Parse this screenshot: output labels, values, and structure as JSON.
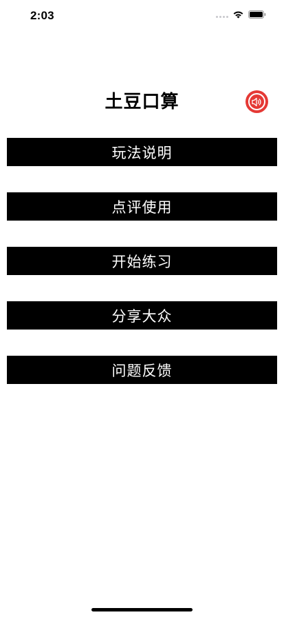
{
  "status_bar": {
    "time": "2:03"
  },
  "header": {
    "title": "土豆口算",
    "sound_icon": "speaker-icon",
    "sound_color": "#e53935"
  },
  "menu": {
    "items": [
      {
        "label": "玩法说明"
      },
      {
        "label": "点评使用"
      },
      {
        "label": "开始练习"
      },
      {
        "label": "分享大众"
      },
      {
        "label": "问题反馈"
      }
    ]
  }
}
